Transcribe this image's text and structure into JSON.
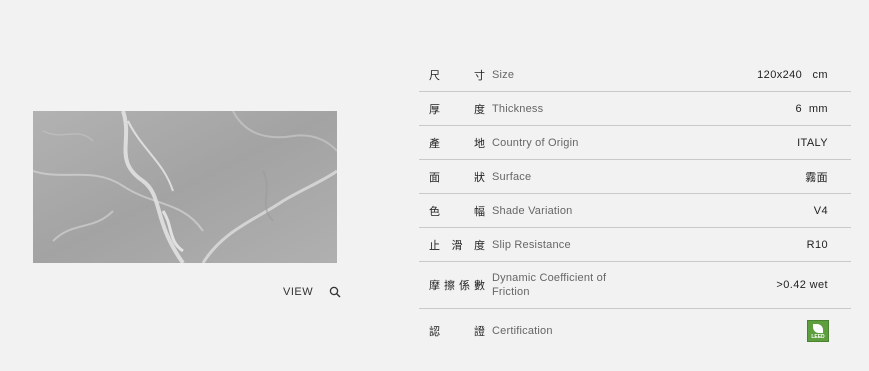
{
  "product": {
    "view_label": "VIEW",
    "search_icon": "search-icon"
  },
  "specs": [
    {
      "zh": [
        "尺",
        "寸"
      ],
      "en": "Size",
      "value": "120x240   cm"
    },
    {
      "zh": [
        "厚",
        "度"
      ],
      "en": "Thickness",
      "value": "6  mm"
    },
    {
      "zh": [
        "產",
        "地"
      ],
      "en": "Country of Origin",
      "value": "ITALY"
    },
    {
      "zh": [
        "面",
        "狀"
      ],
      "en": "Surface",
      "value": "霧面"
    },
    {
      "zh": [
        "色",
        "幅"
      ],
      "en": "Shade Variation",
      "value": "V4"
    },
    {
      "zh": [
        "止",
        "滑",
        "度"
      ],
      "en": "Slip Resistance",
      "value": "R10"
    },
    {
      "zh": [
        "摩",
        "擦",
        "係",
        "數"
      ],
      "en": "Dynamic Coefficient of Friction",
      "value": ">0.42 wet"
    },
    {
      "zh": [
        "認",
        "證"
      ],
      "en": "Certification",
      "value": ""
    }
  ],
  "certification": {
    "badge_icon": "leed-badge-icon",
    "badge_text": "LEED",
    "badge_color": "#5d9e3f"
  },
  "colors": {
    "background": "#f2f2f2",
    "divider": "#c9c9c9",
    "marble_base": "#a8a8a8"
  }
}
